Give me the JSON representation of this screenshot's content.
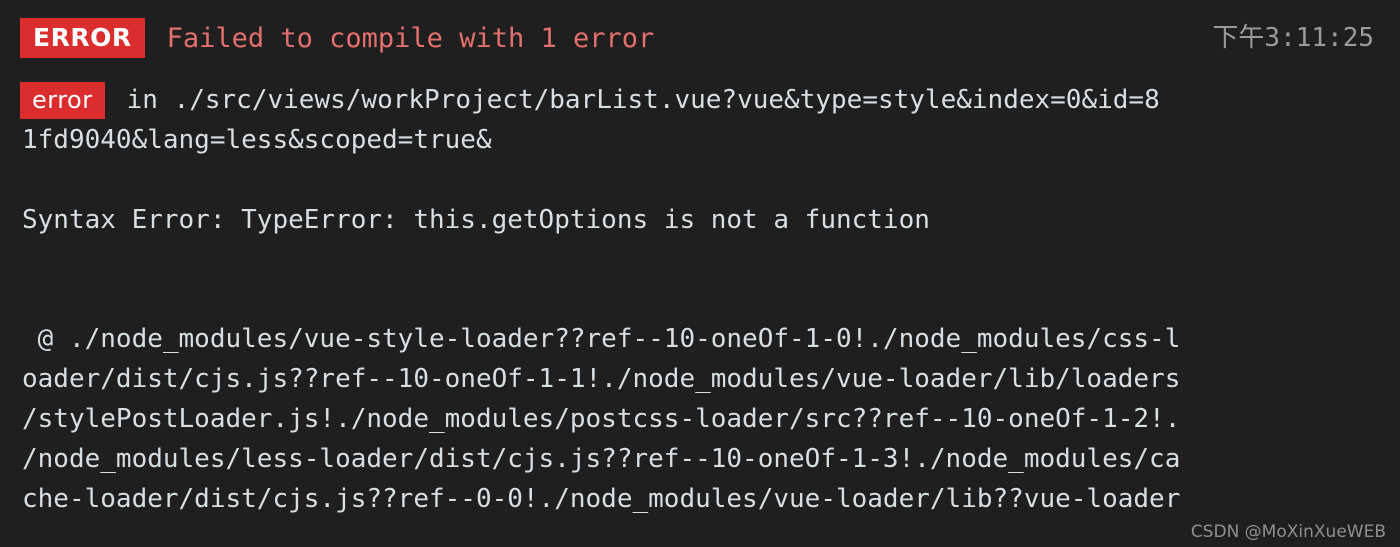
{
  "terminal": {
    "background_color": "#1e1f1e",
    "text_color": "#d8dee2"
  },
  "header": {
    "badge_label": "ERROR",
    "badge_color": "#db2d2d",
    "headline": "Failed to compile with 1 error",
    "headline_color": "#e3706d",
    "timestamp": "下午3:11:25",
    "timestamp_color": "#9b9b9b"
  },
  "error": {
    "badge_label": "error",
    "badge_color": "#db2d2d",
    "first_line": "in ./src/views/workProject/barList.vue?vue&type=style&index=0&id=8",
    "wrapped_line": "1fd9040&lang=less&scoped=true&"
  },
  "syntax_error": {
    "message": "Syntax Error: TypeError: this.getOptions is not a function"
  },
  "module_trace": {
    "lines": [
      " @ ./node_modules/vue-style-loader??ref--10-oneOf-1-0!./node_modules/css-l",
      "oader/dist/cjs.js??ref--10-oneOf-1-1!./node_modules/vue-loader/lib/loaders",
      "/stylePostLoader.js!./node_modules/postcss-loader/src??ref--10-oneOf-1-2!.",
      "/node_modules/less-loader/dist/cjs.js??ref--10-oneOf-1-3!./node_modules/ca",
      "che-loader/dist/cjs.js??ref--0-0!./node_modules/vue-loader/lib??vue-loader"
    ]
  },
  "watermark": {
    "text": "CSDN @MoXinXueWEB"
  }
}
